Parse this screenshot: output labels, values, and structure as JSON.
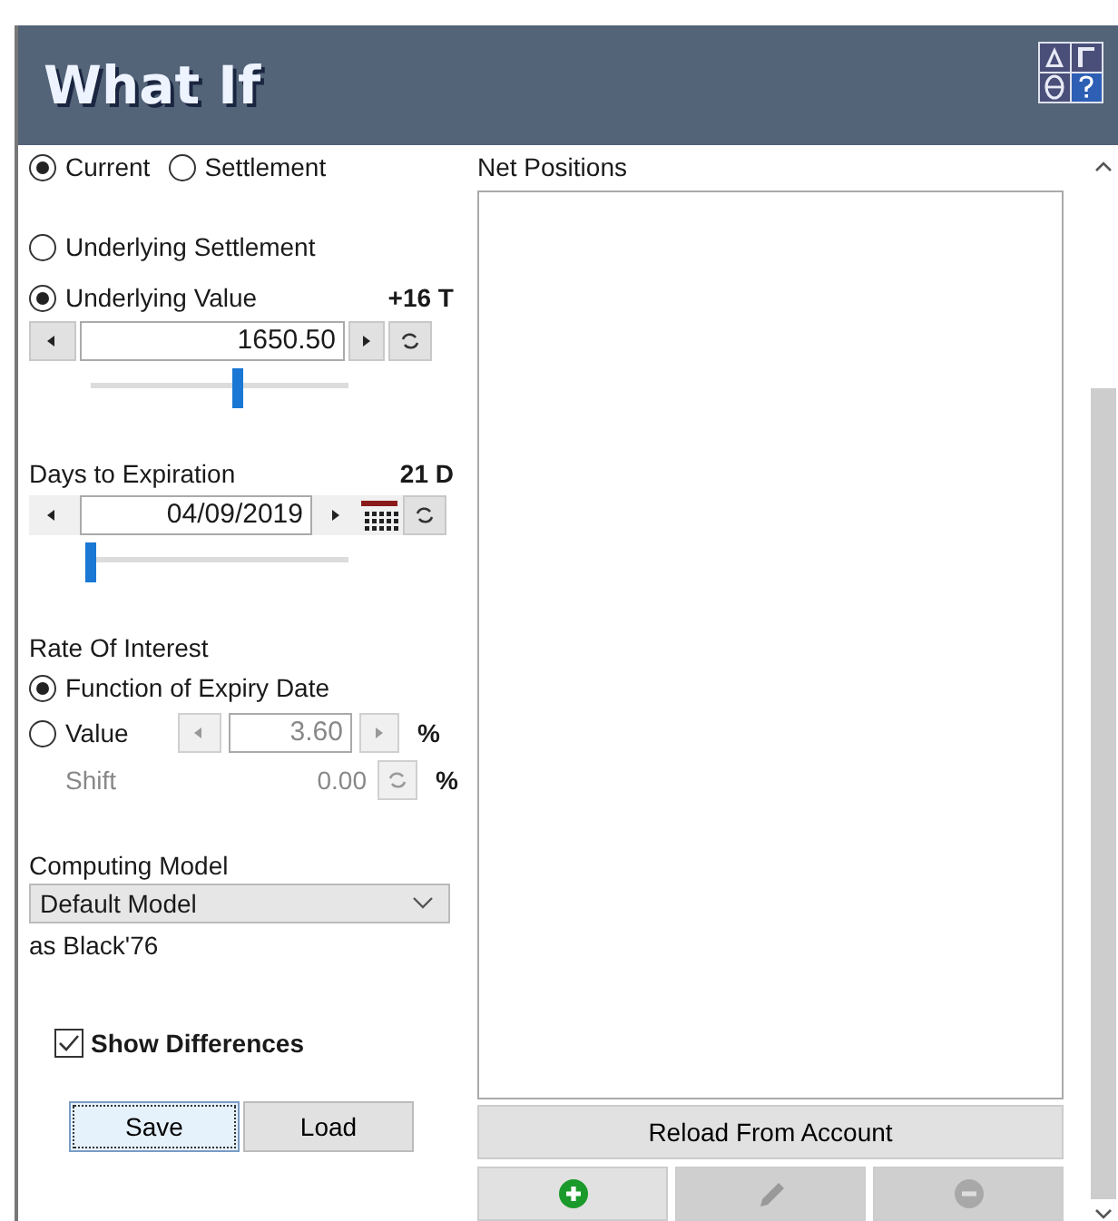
{
  "window": {
    "title": "What If"
  },
  "price_mode": [
    {
      "label": "Current",
      "selected": true
    },
    {
      "label": "Settlement",
      "selected": false
    }
  ],
  "underlying": {
    "options": [
      {
        "label": "Underlying Settlement",
        "selected": false
      },
      {
        "label": "Underlying Value",
        "selected": true
      }
    ],
    "change": "+16 T",
    "value": "1650.50",
    "level": 0.57
  },
  "expiration": {
    "label": "Days to Expiration",
    "days": "21 D",
    "date": "04/09/2019",
    "level": 0
  },
  "interest": {
    "label": "Rate Of Interest",
    "options": [
      {
        "label": "Function of Expiry Date",
        "selected": true
      },
      {
        "label": "Value",
        "selected": false
      }
    ],
    "value": "3.60",
    "unit": "%",
    "shift_label": "Shift",
    "shift": "0.00",
    "shift_unit": "%",
    "disabled": true
  },
  "model": {
    "label": "Computing Model",
    "value": "Default Model",
    "note": "as Black'76"
  },
  "show_differences": {
    "label": "Show Differences",
    "checked": true
  },
  "buttons": [
    {
      "label": "Save",
      "focused": true
    },
    {
      "label": "Load",
      "focused": false
    }
  ],
  "net_positions": {
    "title": "Net Positions",
    "reload": "Reload From Account",
    "actions": [
      {
        "kind": "add",
        "disabled": false
      },
      {
        "kind": "edit",
        "disabled": true
      },
      {
        "kind": "remove",
        "disabled": true
      }
    ]
  }
}
